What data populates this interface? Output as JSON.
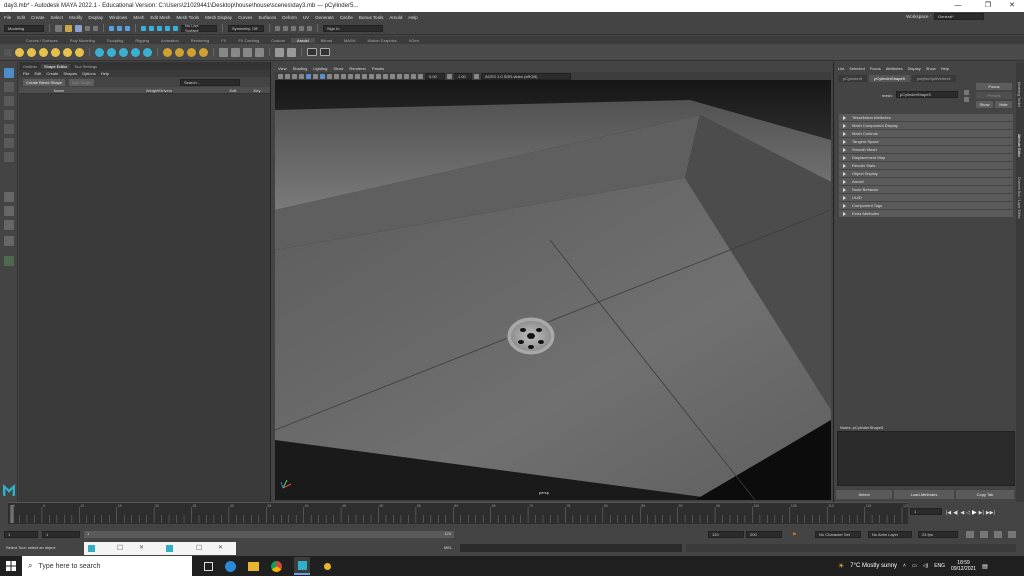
{
  "window": {
    "title": "day3.mb* - Autodesk MAYA 2022.1 - Educational Version: C:\\Users\\21029441\\Desktop\\house\\house\\scenes\\day3.mb  ---  pCylinder5..."
  },
  "menubar": {
    "items": [
      "File",
      "Edit",
      "Create",
      "Select",
      "Modify",
      "Display",
      "Windows",
      "Mesh",
      "Edit Mesh",
      "Mesh Tools",
      "Mesh Display",
      "Curves",
      "Surfaces",
      "Deform",
      "UV",
      "Generate",
      "Cache",
      "Bonus Tools",
      "Arnold",
      "Help"
    ],
    "workspace_label": "Workspace :",
    "workspace_value": "General*"
  },
  "statusline": {
    "mode": "Modeling",
    "live_surface": "No Live Surface",
    "symmetry": "Symmetry: Off",
    "sign_in": "Sign In"
  },
  "shelf_tabs": [
    "Curves / Surfaces",
    "Poly Modeling",
    "Sculpting",
    "Rigging",
    "Animation",
    "Rendering",
    "FX",
    "FX Caching",
    "Custom",
    "Arnold",
    "Bifrost",
    "MASH",
    "Motion Graphics",
    "XGen"
  ],
  "shelf_active": "Arnold",
  "shape_editor": {
    "tabs": [
      "Outliner",
      "Shape Editor",
      "Tool Settings"
    ],
    "active_tab": "Shape Editor",
    "menu": [
      "File",
      "Edit",
      "Create",
      "Shapes",
      "Options",
      "Help"
    ],
    "create_button": "Create Blend Shape",
    "add_target": "Add Target",
    "search_placeholder": "Search...",
    "columns": [
      "Name",
      "Weight/Drivers",
      "Edit",
      "Key"
    ]
  },
  "viewport": {
    "menu": [
      "View",
      "Shading",
      "Lighting",
      "Show",
      "Renderer",
      "Panels"
    ],
    "camera": "persp",
    "gamma": "ACES 1.0 SDR-video (sRGB)",
    "exposure": "0.00",
    "gamma_val": "1.00"
  },
  "attr": {
    "menu": [
      "List",
      "Selected",
      "Focus",
      "Attributes",
      "Display",
      "Show",
      "Help"
    ],
    "tabs": [
      "pCylinder5",
      "pCylinderShape5",
      "polyNoSplitVertex5"
    ],
    "active_tab": "pCylinderShape5",
    "mesh_label": "mesh:",
    "mesh_value": "pCylinderShape5",
    "focus": "Focus",
    "presets": "Presets",
    "show": "Show",
    "hide": "Hide",
    "sections": [
      "Tessellation Attributes",
      "Mesh Component Display",
      "Mesh Controls",
      "Tangent Space",
      "Smooth Mesh",
      "Displacement Map",
      "Render Stats",
      "Object Display",
      "Arnold",
      "Node Behavior",
      "UUID",
      "Component Tags",
      "Extra Attributes"
    ],
    "notes": "Notes:  pCylinderShape5",
    "select": "Select",
    "load": "Load Attributes",
    "copy": "Copy Tab"
  },
  "sidetabs": [
    "Modeling Toolkit",
    "Attribute Editor",
    "Channel Box / Layer Editor"
  ],
  "timeline": {
    "ticks": [
      "1",
      "5",
      "10",
      "15",
      "20",
      "25",
      "30",
      "35",
      "40",
      "45",
      "50",
      "55",
      "60",
      "65",
      "70",
      "75",
      "80",
      "85",
      "90",
      "95",
      "100",
      "105",
      "110",
      "115",
      "120"
    ],
    "current": "1"
  },
  "range": {
    "start": "1",
    "start2": "1",
    "end_inner": "120",
    "end": "120",
    "end2": "200",
    "fps": "24 fps",
    "character": "No Character Set",
    "anim_layer": "No Anim Layer"
  },
  "help": {
    "message": "Select Tool: select an object",
    "mel": "MEL"
  },
  "taskbar": {
    "search": "Type here to search",
    "weather": "7°C  Mostly sunny",
    "lang": "ENG",
    "time": "18:59",
    "date": "09/12/2021"
  }
}
